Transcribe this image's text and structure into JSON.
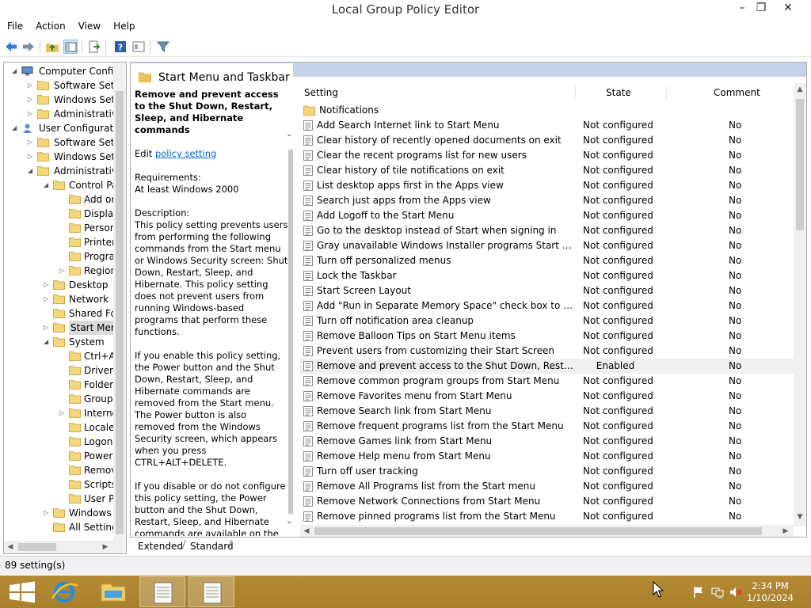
{
  "window": {
    "title": "Local Group Policy Editor",
    "minimize": "–",
    "restore": "❐",
    "close": "✕"
  },
  "menu": [
    "File",
    "Action",
    "View",
    "Help"
  ],
  "tree": {
    "items": [
      {
        "label": "Computer Configu",
        "level": 0,
        "arrow": "◢",
        "icon": "computer"
      },
      {
        "label": "Software Setti",
        "level": 1,
        "arrow": "▷",
        "icon": "folder"
      },
      {
        "label": "Windows Setti",
        "level": 1,
        "arrow": "▷",
        "icon": "folder"
      },
      {
        "label": "Administrative",
        "level": 1,
        "arrow": "▷",
        "icon": "folder"
      },
      {
        "label": "User Configuratio",
        "level": 0,
        "arrow": "◢",
        "icon": "user"
      },
      {
        "label": "Software Setti",
        "level": 1,
        "arrow": "▷",
        "icon": "folder"
      },
      {
        "label": "Windows Setti",
        "level": 1,
        "arrow": "▷",
        "icon": "folder"
      },
      {
        "label": "Administrative",
        "level": 1,
        "arrow": "◢",
        "icon": "folder"
      },
      {
        "label": "Control Pa",
        "level": 2,
        "arrow": "◢",
        "icon": "folder"
      },
      {
        "label": "Add or",
        "level": 3,
        "arrow": "",
        "icon": "folder"
      },
      {
        "label": "Display",
        "level": 3,
        "arrow": "",
        "icon": "folder"
      },
      {
        "label": "Person",
        "level": 3,
        "arrow": "",
        "icon": "folder"
      },
      {
        "label": "Printer",
        "level": 3,
        "arrow": "",
        "icon": "folder"
      },
      {
        "label": "Progra",
        "level": 3,
        "arrow": "",
        "icon": "folder"
      },
      {
        "label": "Region",
        "level": 3,
        "arrow": "▷",
        "icon": "folder"
      },
      {
        "label": "Desktop",
        "level": 2,
        "arrow": "▷",
        "icon": "folder"
      },
      {
        "label": "Network",
        "level": 2,
        "arrow": "▷",
        "icon": "folder"
      },
      {
        "label": "Shared Fol",
        "level": 2,
        "arrow": "",
        "icon": "folder"
      },
      {
        "label": "Start Menu",
        "level": 2,
        "arrow": "▷",
        "icon": "folder",
        "selected": true
      },
      {
        "label": "System",
        "level": 2,
        "arrow": "◢",
        "icon": "folder"
      },
      {
        "label": "Ctrl+A",
        "level": 3,
        "arrow": "",
        "icon": "folder"
      },
      {
        "label": "Driver",
        "level": 3,
        "arrow": "",
        "icon": "folder"
      },
      {
        "label": "Folder",
        "level": 3,
        "arrow": "",
        "icon": "folder"
      },
      {
        "label": "Group",
        "level": 3,
        "arrow": "",
        "icon": "folder"
      },
      {
        "label": "Interne",
        "level": 3,
        "arrow": "▷",
        "icon": "folder"
      },
      {
        "label": "Locale",
        "level": 3,
        "arrow": "",
        "icon": "folder"
      },
      {
        "label": "Logon",
        "level": 3,
        "arrow": "",
        "icon": "folder"
      },
      {
        "label": "Power",
        "level": 3,
        "arrow": "",
        "icon": "folder"
      },
      {
        "label": "Remov",
        "level": 3,
        "arrow": "",
        "icon": "folder"
      },
      {
        "label": "Scripts",
        "level": 3,
        "arrow": "",
        "icon": "folder"
      },
      {
        "label": "User Pr",
        "level": 3,
        "arrow": "",
        "icon": "folder"
      },
      {
        "label": "Windows",
        "level": 2,
        "arrow": "▷",
        "icon": "folder"
      },
      {
        "label": "All Setting",
        "level": 2,
        "arrow": "",
        "icon": "folder"
      }
    ]
  },
  "pane": {
    "title": "Start Menu and Taskbar",
    "desc_title": "Remove and prevent access to the Shut Down, Restart, Sleep, and Hibernate commands",
    "edit_prefix": "Edit ",
    "edit_link": "policy setting",
    "requirements_label": "Requirements:",
    "requirements_value": "At least Windows 2000",
    "description_label": "Description:",
    "description_p1": "This policy setting prevents users from performing the following commands from the Start menu or Windows Security screen: Shut Down, Restart, Sleep, and Hibernate. This policy setting does not prevent users from running Windows-based programs that perform these functions.",
    "description_p2": "If you enable this policy setting, the Power button and the Shut Down, Restart, Sleep, and Hibernate commands are removed from the Start menu. The Power button is also removed from the Windows Security screen, which appears when you press CTRL+ALT+DELETE.",
    "description_p3": "If you disable or do not configure this policy setting, the Power button and the Shut Down, Restart, Sleep, and Hibernate commands are available on the Start menu. The Power button on the Windows Security screen is also available."
  },
  "list": {
    "columns": {
      "setting": "Setting",
      "state": "State",
      "comment": "Comment"
    },
    "rows": [
      {
        "name": "Notifications",
        "state": "",
        "comment": "",
        "folder": true
      },
      {
        "name": "Add Search Internet link to Start Menu",
        "state": "Not configured",
        "comment": "No"
      },
      {
        "name": "Clear history of recently opened documents on exit",
        "state": "Not configured",
        "comment": "No"
      },
      {
        "name": "Clear the recent programs list for new users",
        "state": "Not configured",
        "comment": "No"
      },
      {
        "name": "Clear history of tile notifications on exit",
        "state": "Not configured",
        "comment": "No"
      },
      {
        "name": "List desktop apps first in the Apps view",
        "state": "Not configured",
        "comment": "No"
      },
      {
        "name": "Search just apps from the Apps view",
        "state": "Not configured",
        "comment": "No"
      },
      {
        "name": "Add Logoff to the Start Menu",
        "state": "Not configured",
        "comment": "No"
      },
      {
        "name": "Go to the desktop instead of Start when signing in",
        "state": "Not configured",
        "comment": "No"
      },
      {
        "name": "Gray unavailable Windows Installer programs Start Menu sh...",
        "state": "Not configured",
        "comment": "No"
      },
      {
        "name": "Turn off personalized menus",
        "state": "Not configured",
        "comment": "No"
      },
      {
        "name": "Lock the Taskbar",
        "state": "Not configured",
        "comment": "No"
      },
      {
        "name": "Start Screen Layout",
        "state": "Not configured",
        "comment": "No"
      },
      {
        "name": "Add \"Run in Separate Memory Space\" check box to Run dial...",
        "state": "Not configured",
        "comment": "No"
      },
      {
        "name": "Turn off notification area cleanup",
        "state": "Not configured",
        "comment": "No"
      },
      {
        "name": "Remove Balloon Tips on Start Menu items",
        "state": "Not configured",
        "comment": "No"
      },
      {
        "name": "Prevent users from customizing their Start Screen",
        "state": "Not configured",
        "comment": "No"
      },
      {
        "name": "Remove and prevent access to the Shut Down, Restart, Sleep...",
        "state": "Enabled",
        "comment": "No",
        "selected": true
      },
      {
        "name": "Remove common program groups from Start Menu",
        "state": "Not configured",
        "comment": "No"
      },
      {
        "name": "Remove Favorites menu from Start Menu",
        "state": "Not configured",
        "comment": "No"
      },
      {
        "name": "Remove Search link from Start Menu",
        "state": "Not configured",
        "comment": "No"
      },
      {
        "name": "Remove frequent programs list from the Start Menu",
        "state": "Not configured",
        "comment": "No"
      },
      {
        "name": "Remove Games link from Start Menu",
        "state": "Not configured",
        "comment": "No"
      },
      {
        "name": "Remove Help menu from Start Menu",
        "state": "Not configured",
        "comment": "No"
      },
      {
        "name": "Turn off user tracking",
        "state": "Not configured",
        "comment": "No"
      },
      {
        "name": "Remove All Programs list from the Start menu",
        "state": "Not configured",
        "comment": "No"
      },
      {
        "name": "Remove Network Connections from Start Menu",
        "state": "Not configured",
        "comment": "No"
      },
      {
        "name": "Remove pinned programs list from the Start Menu",
        "state": "Not configured",
        "comment": "No"
      }
    ]
  },
  "tabs": {
    "extended": "Extended",
    "standard": "Standard"
  },
  "status": {
    "text": "89 setting(s)"
  },
  "taskbar": {
    "time": "2:34 PM",
    "date": "1/10/2024",
    "accent": "#b08632"
  }
}
